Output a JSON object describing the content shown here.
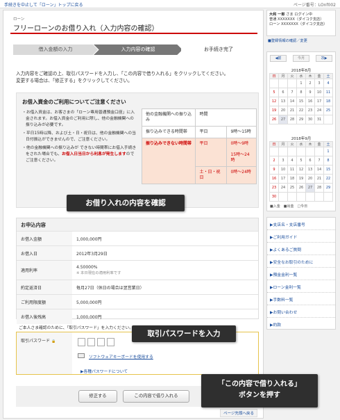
{
  "topbar": {
    "back_link": "手続きを中止して「ローン」トップに戻る",
    "page_number": "ページ番号：LOnf002"
  },
  "header": {
    "subtitle": "ローン",
    "title": "フリーローンのお借り入れ（入力内容の確認）"
  },
  "steps": [
    "借入金額の入力",
    "入力内容の確認",
    "お手続き完了"
  ],
  "intro": {
    "line1": "入力内容をご確認の上、取引パスワードを入力し、「この内容で借り入れる」をクリックしてください。",
    "line2": "変更する場合は、「修正する」をクリックしてください。"
  },
  "notice": {
    "heading": "お借入資金のご利用についてご注意ください",
    "bullets": [
      "お借入資金は、お客さまの「ローン専用普通預金口座」に入金されます。お借入資金のご利用に際し、他の金融機関への振り込みが必要です。",
      "平日15時以降、および土・日・祝日は、他の金融機関への当日付振込ができませんので、ご注意ください。"
    ],
    "bullet3_pre": "他の金融機関への振り込みが できない時間帯にお借入手続きをされた場合でも、",
    "bullet3_red": "お借入日当日から利息が発生します",
    "bullet3_post": "のでご注意ください。",
    "table": {
      "h1": "他の金融機関への振り込み",
      "h2": "時間",
      "r1_label": "振り込みできる時間帯",
      "r1_day": "平日",
      "r1_time": "9時〜15時",
      "r2_label": "振り込みできない時間帯",
      "r2_day": "平日",
      "r2_time_a": "0時〜9時",
      "r2_time_b": "15時〜24時",
      "r3_day": "土・日・祝日",
      "r3_time": "0時〜24時"
    }
  },
  "callouts": {
    "c1": "お借り入れの内容を確認",
    "c2": "取引パスワードを入力",
    "c3_line1": "「この内容で借り入れる」",
    "c3_line2": "ボタンを押す"
  },
  "application": {
    "heading": "お申込内容",
    "rows": [
      {
        "label": "お借入金額",
        "value": "1,000,000円",
        "note": ""
      },
      {
        "label": "お借入日",
        "value": "2012年3月29日",
        "note": ""
      },
      {
        "label": "適用利率",
        "value": "4.50000%",
        "note": "※ 本日現在の適用利率です"
      },
      {
        "label": "約定返済日",
        "value": "毎月27日（休日の場合は翌営業日）",
        "note": ""
      },
      {
        "label": "ご利用限度額",
        "value": "5,000,000円",
        "note": ""
      },
      {
        "label": "お借入後残高",
        "value": "1,000,000円",
        "note": ""
      }
    ]
  },
  "password": {
    "confirm_text": "ご本人さま確認のために、「取引パスワード」を入力ください。",
    "label": "取引パスワード",
    "lock": "🔒",
    "keyboard_link": "ソフトウェアキーボードを使用する",
    "about_link": "各種パスワードについて"
  },
  "buttons": {
    "modify": "修正する",
    "submit": "この内容で借り入れる",
    "page_top": "ページ先頭へ戻る"
  },
  "sidebar": {
    "user_name": "大和 一郎",
    "user_suffix": "さま",
    "login_status": "ログイン中",
    "account1_label": "普通",
    "account1_value": "XXXXXXX（ダイコク支店）",
    "account2_label": "ローン",
    "account2_value": "XXXXXXX（ダイコク支店）",
    "reg_link": "登録情報の確認／変更",
    "cal_prev": "◀前",
    "cal_today": "今月",
    "cal_next": "次▶",
    "month1": "2018年8月",
    "month2": "2018年9月",
    "weekdays": [
      "日",
      "月",
      "火",
      "水",
      "木",
      "金",
      "土"
    ],
    "legend": "■入金　■出金　□今日",
    "menu": [
      "支店名・支店番号",
      "ご利用ガイド",
      "よくあるご質問",
      "安全なお取引のために",
      "預金金利一覧",
      "ローン金利一覧",
      "手数料一覧",
      "お問い合わせ",
      "約款"
    ]
  }
}
